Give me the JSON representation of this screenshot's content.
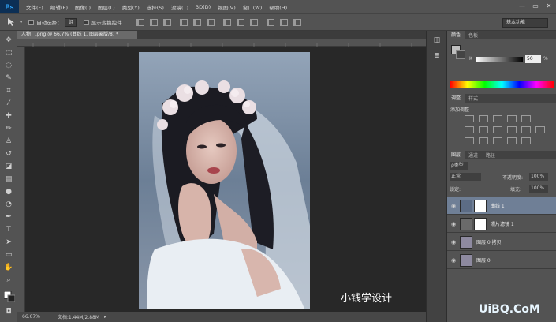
{
  "app": {
    "logo": "Ps"
  },
  "menu": [
    "文件(F)",
    "编辑(E)",
    "图像(I)",
    "图层(L)",
    "类型(Y)",
    "选择(S)",
    "滤镜(T)",
    "3D(D)",
    "视图(V)",
    "窗口(W)",
    "帮助(H)"
  ],
  "window_controls": {
    "minimize": "—",
    "restore": "▭",
    "close": "✕"
  },
  "options": {
    "auto_select_label": "自动选择：",
    "auto_select_value": "组",
    "show_transform_label": "显示变换控件",
    "workspace": "基本功能"
  },
  "document": {
    "tab_title": "人物，.png @ 66.7% (曲线 1, 图层蒙版/8) *",
    "zoom": "66.67%",
    "doc_size": "文档:1.44M/2.88M"
  },
  "panels": {
    "color_tabs": [
      "颜色",
      "色板"
    ],
    "k_label": "K",
    "k_value": "50",
    "k_percent": "%",
    "adjust_tabs": [
      "调整",
      "样式"
    ],
    "adjust_title": "添加调整",
    "layers_tabs": [
      "图层",
      "通道",
      "路径"
    ],
    "filter_kind": "ρ类型",
    "blend_mode": "正常",
    "opacity_label": "不透明度:",
    "opacity_value": "100%",
    "lock_label": "锁定:",
    "fill_label": "填充:",
    "fill_value": "100%",
    "layers": [
      {
        "name": "曲线 1",
        "selected": true
      },
      {
        "name": "照片滤镜 1",
        "selected": false
      },
      {
        "name": "图层 0 拷贝",
        "selected": false
      },
      {
        "name": "图层 0",
        "selected": false
      }
    ]
  },
  "watermark": {
    "line1": "小钱学设计",
    "line2": "UiBQ.CoM"
  },
  "colors": {
    "photo_bg": "#7a8da4",
    "selected_layer": "#6f7f96",
    "ps_blue": "#31a8ff"
  }
}
